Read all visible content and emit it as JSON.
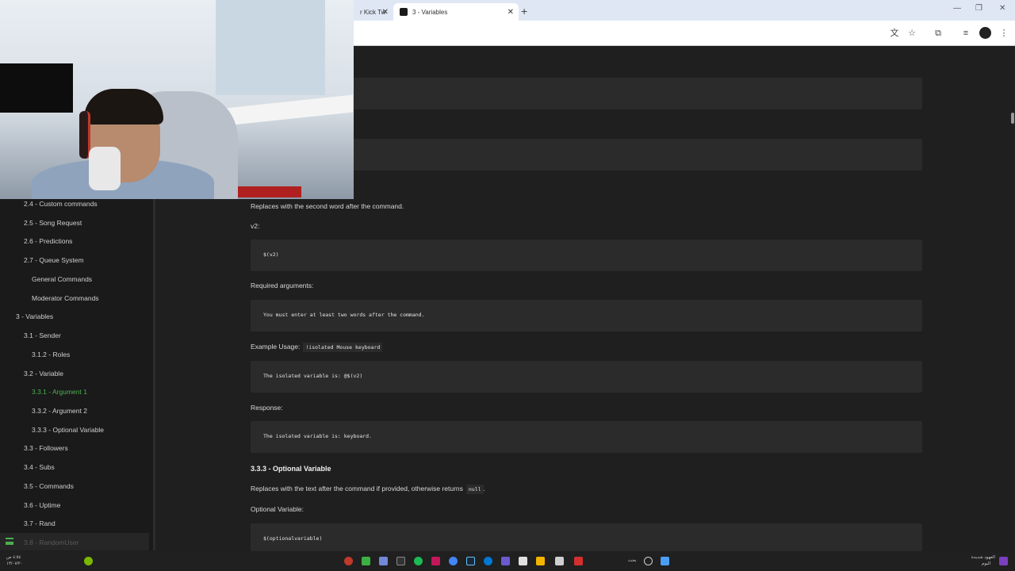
{
  "browser": {
    "tabs": [
      {
        "label": "r Kick Tw",
        "active": false
      },
      {
        "label": "3 - Variables",
        "active": true
      }
    ],
    "new_tab": "+",
    "close": "✕",
    "minimize": "—",
    "restore": "❐",
    "window_close": "✕"
  },
  "sidebar": {
    "items": [
      {
        "label": "2.4 - Custom commands",
        "level": 2
      },
      {
        "label": "2.5 - Song Request",
        "level": 2
      },
      {
        "label": "2.6 - Predictions",
        "level": 2
      },
      {
        "label": "2.7 - Queue System",
        "level": 2
      },
      {
        "label": "General Commands",
        "level": 3
      },
      {
        "label": "Moderator Commands",
        "level": 3
      },
      {
        "label": "3 - Variables",
        "level": 1
      },
      {
        "label": "3.1 - Sender",
        "level": 2
      },
      {
        "label": "3.1.2 - Roles",
        "level": 3
      },
      {
        "label": "3.2 - Variable",
        "level": 2
      },
      {
        "label": "3.3.1 - Argument 1",
        "level": 3,
        "active": true
      },
      {
        "label": "3.3.2 - Argument 2",
        "level": 3
      },
      {
        "label": "3.3.3 - Optional Variable",
        "level": 3
      },
      {
        "label": "3.3 - Followers",
        "level": 2
      },
      {
        "label": "3.4 - Subs",
        "level": 2
      },
      {
        "label": "3.5 - Commands",
        "level": 2
      },
      {
        "label": "3.6 - Uptime",
        "level": 2
      },
      {
        "label": "3.7 - Rand",
        "level": 2
      }
    ],
    "footer_item": "3.8 - RandomUser",
    "active_color": "#4caf50"
  },
  "content": {
    "replaces_text": "Replaces with the second word after the command.",
    "v2_label": "v2:",
    "v2_code": "$(v2)",
    "required_label": "Required arguments:",
    "required_code": "You must enter at least two words after the command.",
    "example_label": "Example Usage:",
    "example_inline": "!isolated Mouse keyboard",
    "example_code": "The isolated variable is: @$(v2)",
    "response_label": "Response:",
    "response_code": "The isolated variable is: keyboard.",
    "section_title": "3.3.3 - Optional Variable",
    "optional_desc": "Replaces with the text after the command if provided, otherwise returns",
    "optional_null": "null",
    "optional_desc_end": ".",
    "optional_label": "Optional Variable:",
    "optional_code": "$(optionalvariable)"
  },
  "taskbar": {
    "time": "٤:٥٤ ص",
    "date": "١٣/٠٧/٢٠",
    "search_text": "بحث",
    "news_text": "العهود شديدة",
    "news_sub": "اليوم"
  }
}
